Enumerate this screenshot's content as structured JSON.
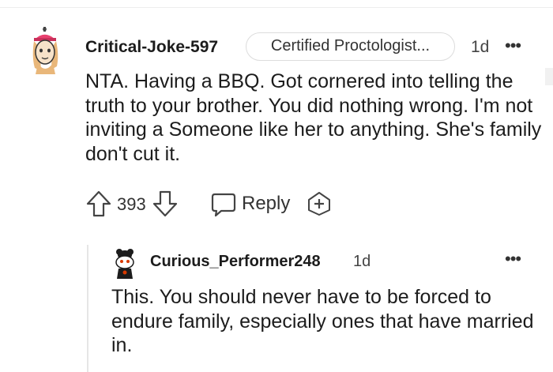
{
  "comment": {
    "author": "Critical-Joke-597",
    "flair": "Certified Proctologist...",
    "time": "1d",
    "more_icon": "more-horizontal-icon",
    "body": "NTA. Having a BBQ. Got cornered into telling the truth to your brother. You did nothing wrong. I'm not inviting a Someone like her to anything. She's family don't cut it.",
    "score": "393",
    "reply_label": "Reply"
  },
  "reply": {
    "author": "Curious_Performer248",
    "time": "1d",
    "body": "This. You should never have to be forced to endure family, especially ones that have married in."
  }
}
